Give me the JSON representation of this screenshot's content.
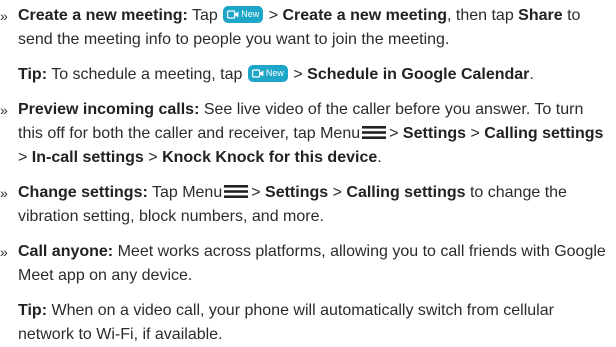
{
  "bullet_mark": "»",
  "colors": {
    "new_button": "#1ea6c9",
    "text": "#2b2b2b"
  },
  "new_button": {
    "icon": "video-camera-icon",
    "label": "New"
  },
  "menu_icon": "hamburger-menu-icon",
  "items": [
    {
      "title": "Create a new meeting:",
      "t1": "Tap",
      "t2": ">",
      "b1": "Create a new meeting",
      "t3": ", then tap",
      "b2": "Share",
      "t4": "to send the meeting info to people you want to join the meeting."
    },
    {
      "title": "Tip:",
      "t1": "To schedule a meeting, tap",
      "t2": ">",
      "b1": "Schedule in Google Calendar",
      "t3": "."
    },
    {
      "title": "Preview incoming calls:",
      "t1": "See live video of the caller before you answer. To turn this off for both the caller and receiver, tap Menu",
      "t2": ">",
      "b1": "Settings",
      "t3": ">",
      "b2": "Calling settings",
      "t4": ">",
      "b3": "In-call settings",
      "t5": ">",
      "b4": "Knock Knock for this device",
      "t6": "."
    },
    {
      "title": "Change settings:",
      "t1": "Tap Menu",
      "t2": ">",
      "b1": "Settings",
      "t3": ">",
      "b2": "Calling settings",
      "t4": "to change the vibration setting, block numbers, and more."
    },
    {
      "title": "Call anyone:",
      "t1": "Meet works across platforms, allowing you to call friends with Google Meet app on any device."
    },
    {
      "title": "Tip:",
      "t1": "When on a video call, your phone will automatically switch from cellular network to Wi-Fi, if available."
    }
  ]
}
